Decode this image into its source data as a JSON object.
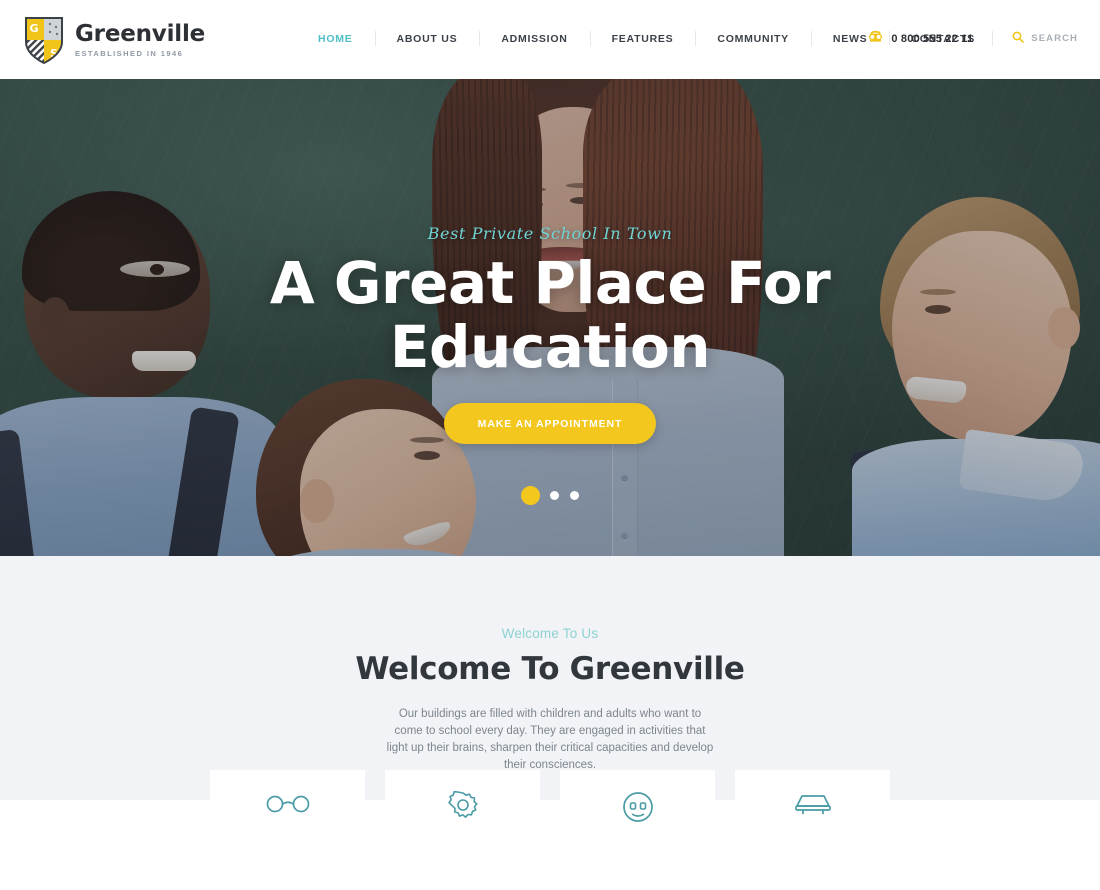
{
  "header": {
    "logo": {
      "name": "Greenville",
      "tagline": "ESTABLISHED IN 1946",
      "shield_letter_1": "G",
      "shield_letter_2": "S",
      "icon": "shield-logo-icon"
    },
    "nav": [
      {
        "label": "HOME",
        "active": true
      },
      {
        "label": "ABOUT US",
        "active": false
      },
      {
        "label": "ADMISSION",
        "active": false
      },
      {
        "label": "FEATURES",
        "active": false
      },
      {
        "label": "COMMUNITY",
        "active": false
      },
      {
        "label": "NEWS",
        "active": false
      },
      {
        "label": "CONTACTS",
        "active": false
      }
    ],
    "phone": {
      "icon": "phone-icon",
      "number": "0 800 555 22 11"
    },
    "search": {
      "icon": "search-icon",
      "label": "SEARCH"
    }
  },
  "hero": {
    "subtitle": "Best Private School In Town",
    "title_line_1": "A Great Place For",
    "title_line_2": "Education",
    "cta_label": "MAKE AN APPOINTMENT",
    "slider": {
      "dots": 3,
      "active_index": 0
    }
  },
  "welcome": {
    "eyebrow": "Welcome To Us",
    "title": "Welcome To Greenville",
    "paragraph": "Our buildings are filled with children and adults who want to come to school every day. They are engaged in activities that light up their brains, sharpen their critical capacities and develop their consciences."
  },
  "feature_cards": [
    {
      "icon": "glasses-icon"
    },
    {
      "icon": "gear-icon"
    },
    {
      "icon": "face-icon"
    },
    {
      "icon": "book-icon"
    }
  ],
  "colors": {
    "accent_teal": "#4fc0c7",
    "accent_yellow": "#f3c71d",
    "text_dark": "#2d3034",
    "text_muted": "#7d858e",
    "section_bg": "#f1f3f6"
  }
}
